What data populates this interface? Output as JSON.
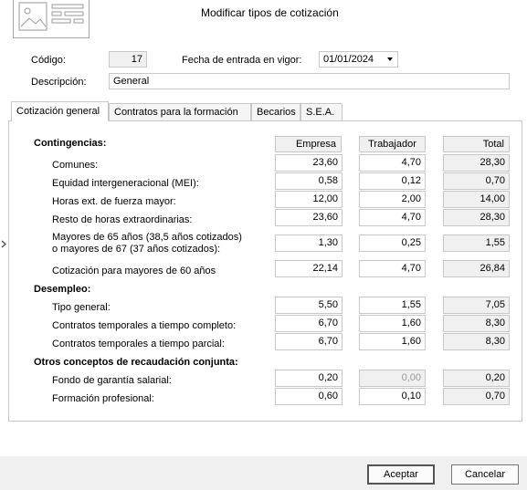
{
  "dialog": {
    "title": "Modificar tipos de cotización"
  },
  "header": {
    "codigo_label": "Código:",
    "codigo_value": "17",
    "fecha_label": "Fecha de entrada en vigor:",
    "fecha_value": "01/01/2024",
    "descripcion_label": "Descripción:",
    "descripcion_value": "General"
  },
  "tabs": [
    {
      "label": "Cotización general",
      "active": true
    },
    {
      "label": "Contratos para la formación",
      "active": false
    },
    {
      "label": "Becarios",
      "active": false
    },
    {
      "label": "S.E.A.",
      "active": false
    }
  ],
  "columns": {
    "empresa": "Empresa",
    "trabajador": "Trabajador",
    "total": "Total"
  },
  "sections": {
    "contingencias": "Contingencias:",
    "desempleo": "Desempleo:",
    "otros": "Otros conceptos de recaudación conjunta:"
  },
  "contingencias_rows": [
    {
      "label": "Comunes:",
      "empresa": "23,60",
      "trabajador": "4,70",
      "total": "28,30"
    },
    {
      "label": "Equidad intergeneracional (MEI):",
      "empresa": "0,58",
      "trabajador": "0,12",
      "total": "0,70"
    },
    {
      "label": "Horas ext. de fuerza mayor:",
      "empresa": "12,00",
      "trabajador": "2,00",
      "total": "14,00"
    },
    {
      "label": "Resto de horas extraordinarias:",
      "empresa": "23,60",
      "trabajador": "4,70",
      "total": "28,30"
    },
    {
      "label_line1": "Mayores de 65 años (38,5 años cotizados)",
      "label_line2": "o mayores de 67 (37 años cotizados):",
      "empresa": "1,30",
      "trabajador": "0,25",
      "total": "1,55"
    },
    {
      "label": "Cotización para mayores de 60 años",
      "empresa": "22,14",
      "trabajador": "4,70",
      "total": "26,84"
    }
  ],
  "desempleo_rows": [
    {
      "label": "Tipo general:",
      "empresa": "5,50",
      "trabajador": "1,55",
      "total": "7,05"
    },
    {
      "label": "Contratos temporales a tiempo completo:",
      "empresa": "6,70",
      "trabajador": "1,60",
      "total": "8,30"
    },
    {
      "label": "Contratos temporales a tiempo parcial:",
      "empresa": "6,70",
      "trabajador": "1,60",
      "total": "8,30"
    }
  ],
  "otros_rows": [
    {
      "label": "Fondo de garantía salarial:",
      "empresa": "0,20",
      "trabajador": "0,00",
      "total": "0,20"
    },
    {
      "label": "Formación profesional:",
      "empresa": "0,60",
      "trabajador": "0,10",
      "total": "0,70"
    }
  ],
  "buttons": {
    "accept": "Aceptar",
    "cancel": "Cancelar"
  },
  "icons": {
    "logo": "image-placeholder-icon",
    "dropdown": "chevron-down-icon",
    "side": "chevron-right-icon"
  }
}
